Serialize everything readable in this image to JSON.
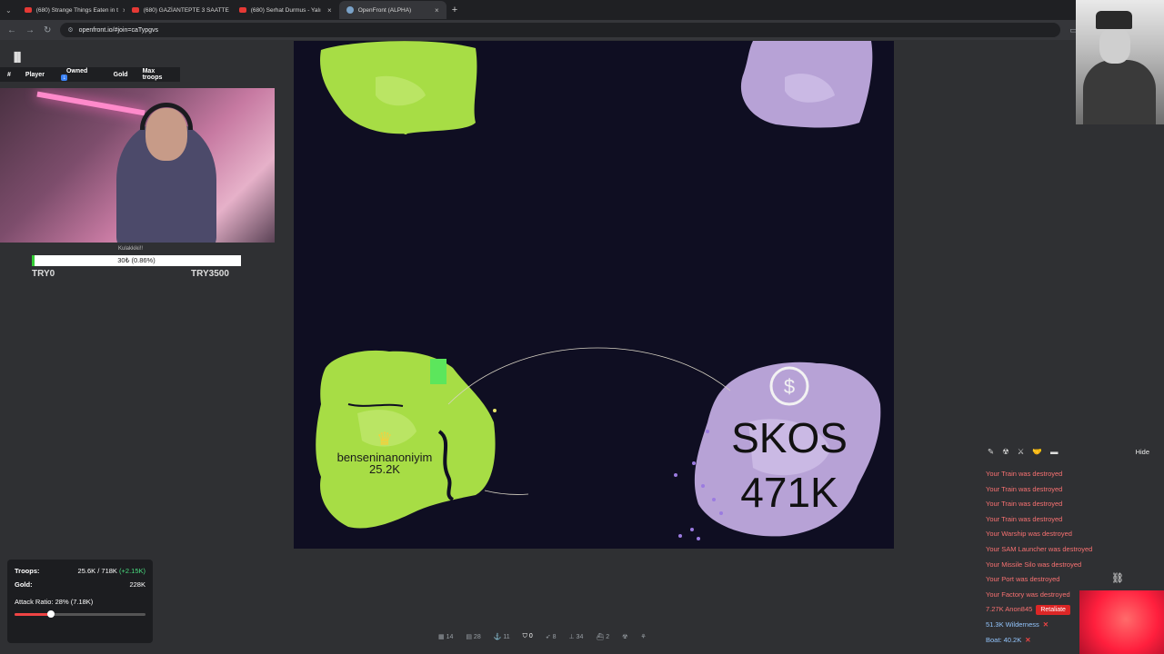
{
  "browser": {
    "tabs": [
      {
        "title": "(680) Strange Things Eaten in t",
        "active": false
      },
      {
        "title": "(680) GAZİANTEPTE 3 SAATTE",
        "active": false
      },
      {
        "title": "(680) Serhat Durmus - Yalı",
        "active": false
      },
      {
        "title": "OpenFront (ALPHA)",
        "active": true
      }
    ],
    "url": "openfront.io/#join=caTypgvs"
  },
  "leaderboard": {
    "columns": [
      "#",
      "Player",
      "Owned",
      "Gold",
      "Max troops"
    ],
    "owned_badge": "↓"
  },
  "progress": {
    "label": "Kulakkiki!!",
    "text": "30₺ (0.86%)",
    "fraction": 0.0086,
    "left": "TRY0",
    "right": "TRY3500"
  },
  "map": {
    "players": [
      {
        "name": "benseninanoniyim",
        "troops": "25.2K"
      },
      {
        "name": "SKOS",
        "troops": "471K"
      }
    ],
    "colors": {
      "green": "#a7dd45",
      "purple": "#b7a2d6",
      "ocean": "#0f0e22"
    }
  },
  "stats": {
    "troops_label": "Troops:",
    "troops_value": "25.6K / 718K",
    "troops_delta": "(+2.15K)",
    "gold_label": "Gold:",
    "gold_value": "228K",
    "attack_label": "Attack Ratio: 28% (7.18K)",
    "attack_fraction": 0.28
  },
  "events": {
    "hide_label": "Hide",
    "messages": [
      "Your Train was destroyed",
      "Your Train was destroyed",
      "Your Train was destroyed",
      "Your Train was destroyed",
      "Your Warship was destroyed",
      "Your SAM Launcher was destroyed",
      "Your Missile Silo was destroyed",
      "Your Port was destroyed",
      "Your Factory was destroyed"
    ],
    "incoming": [
      {
        "text": "7.27K Anon845",
        "action": "Retaliate"
      },
      {
        "text": "51.3K Wilderness"
      },
      {
        "text": "Boat: 40.2K"
      }
    ]
  },
  "bottom_bar": [
    {
      "icon": "city-icon",
      "count": "14"
    },
    {
      "icon": "factory-icon",
      "count": "28"
    },
    {
      "icon": "port-icon",
      "count": "11"
    },
    {
      "icon": "defense-icon",
      "count": "0"
    },
    {
      "icon": "missile-icon",
      "count": "8"
    },
    {
      "icon": "sam-icon",
      "count": "34"
    },
    {
      "icon": "warship-icon",
      "count": "2"
    },
    {
      "icon": "nuke-icon",
      "count": ""
    },
    {
      "icon": "mirv-icon",
      "count": ""
    }
  ]
}
